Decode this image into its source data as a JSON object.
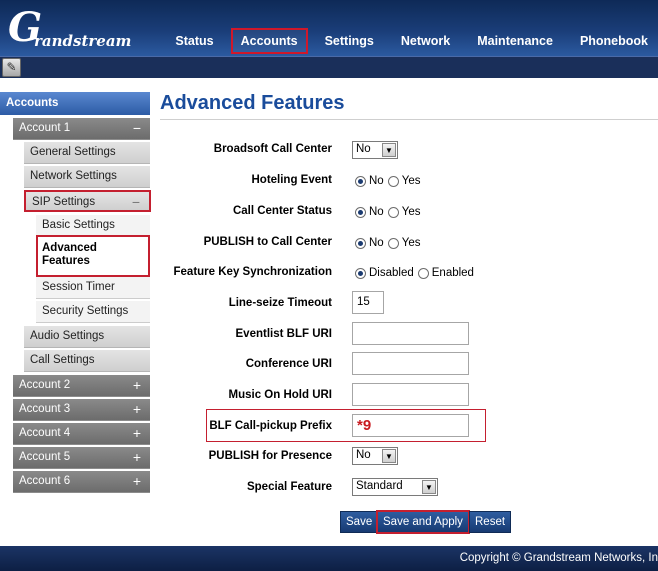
{
  "brand": {
    "logo_letter": "G",
    "logo_text": "randstream"
  },
  "nav": {
    "items": [
      {
        "label": "Status"
      },
      {
        "label": "Accounts",
        "active": true
      },
      {
        "label": "Settings"
      },
      {
        "label": "Network"
      },
      {
        "label": "Maintenance"
      },
      {
        "label": "Phonebook"
      }
    ]
  },
  "toolbar": {
    "icon": "edit-icon"
  },
  "sidebar": {
    "header": "Accounts",
    "account1": "Account 1",
    "general": "General Settings",
    "network": "Network Settings",
    "sip": "SIP Settings",
    "basic": "Basic Settings",
    "advanced": "Advanced Features",
    "session": "Session Timer",
    "security": "Security Settings",
    "audio": "Audio Settings",
    "call": "Call Settings",
    "account2": "Account 2",
    "account3": "Account 3",
    "account4": "Account 4",
    "account5": "Account 5",
    "account6": "Account 6",
    "minus": "−",
    "plus": "+"
  },
  "page": {
    "title": "Advanced Features"
  },
  "form": {
    "broadsoft": {
      "label": "Broadsoft Call Center",
      "value": "No"
    },
    "hoteling": {
      "label": "Hoteling Event",
      "opt1": "No",
      "opt2": "Yes",
      "selected": "No"
    },
    "ccstatus": {
      "label": "Call Center Status",
      "opt1": "No",
      "opt2": "Yes",
      "selected": "No"
    },
    "publish_cc": {
      "label": "PUBLISH to Call Center",
      "opt1": "No",
      "opt2": "Yes",
      "selected": "No"
    },
    "fks": {
      "label": "Feature Key Synchronization",
      "opt1": "Disabled",
      "opt2": "Enabled",
      "selected": "Disabled"
    },
    "lineseize": {
      "label": "Line-seize Timeout",
      "value": "15"
    },
    "eventlist": {
      "label": "Eventlist BLF URI",
      "value": ""
    },
    "conference": {
      "label": "Conference URI",
      "value": ""
    },
    "moh": {
      "label": "Music On Hold URI",
      "value": ""
    },
    "blf_pickup": {
      "label": "BLF Call-pickup Prefix",
      "value": "*9"
    },
    "publish_presence": {
      "label": "PUBLISH for Presence",
      "value": "No"
    },
    "special": {
      "label": "Special Feature",
      "value": "Standard"
    }
  },
  "buttons": {
    "save": "Save",
    "save_apply": "Save and Apply",
    "reset": "Reset"
  },
  "footer": {
    "copyright": "Copyright © Grandstream Networks, In"
  },
  "colors": {
    "header_bg": "#1a3d78",
    "accent_red": "#c41f2f",
    "title_blue": "#1a4c9b",
    "button_bg": "#1f4786",
    "value_red": "#c8191f"
  }
}
